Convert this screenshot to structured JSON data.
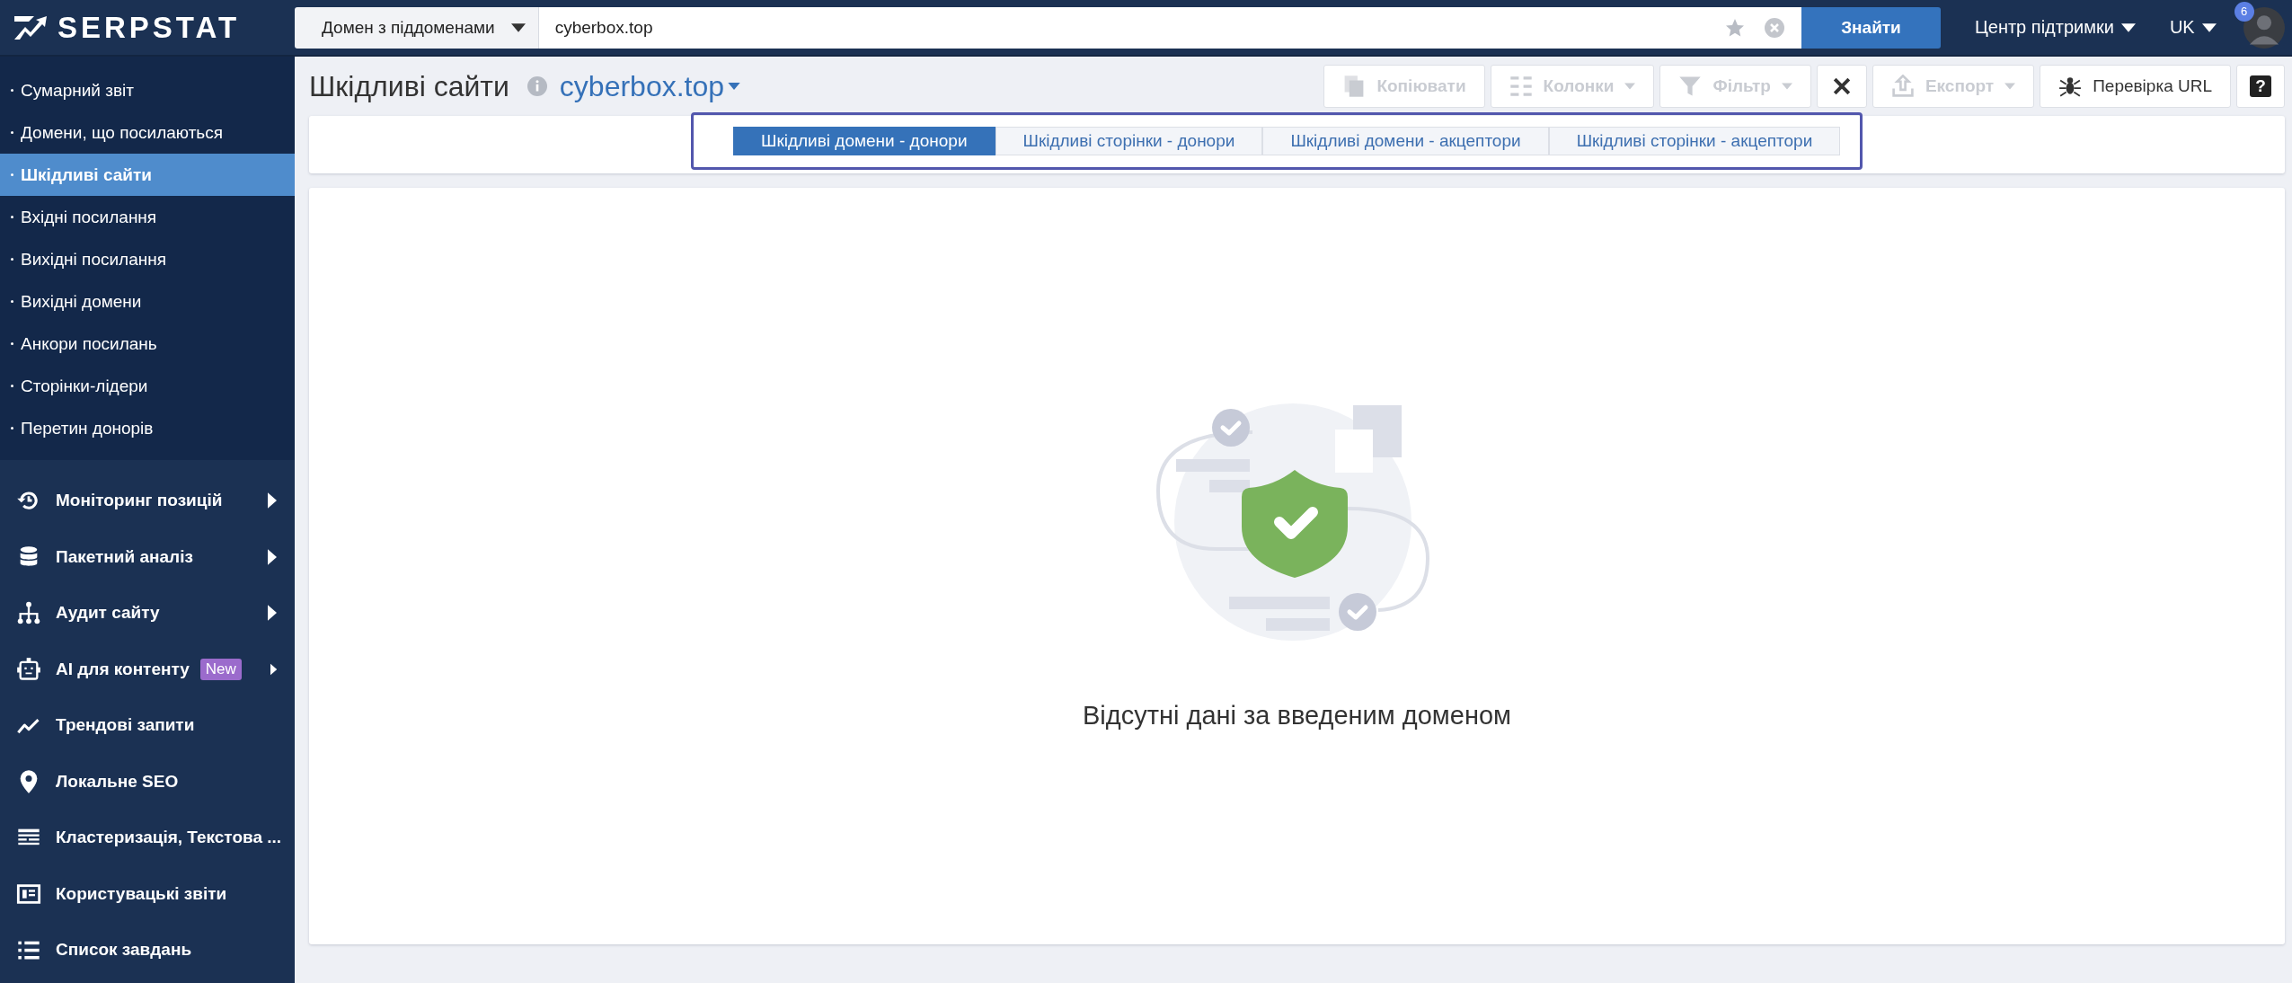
{
  "header": {
    "logo": "SERPSTAT",
    "search_scope": "Домен з піддоменами",
    "search_value": "cyberbox.top",
    "search_button": "Знайти",
    "support": "Центр підтримки",
    "language": "UK",
    "notifications": "6"
  },
  "sidebar": {
    "submenu": [
      {
        "label": "Сумарний звіт",
        "selected": false
      },
      {
        "label": "Домени, що посилаються",
        "selected": false
      },
      {
        "label": "Шкідливі сайти",
        "selected": true
      },
      {
        "label": "Вхідні посилання",
        "selected": false
      },
      {
        "label": "Вихідні посилання",
        "selected": false
      },
      {
        "label": "Вихідні домени",
        "selected": false
      },
      {
        "label": "Анкори посилань",
        "selected": false
      },
      {
        "label": "Сторінки-лідери",
        "selected": false
      },
      {
        "label": "Перетин донорів",
        "selected": false
      }
    ],
    "items": [
      {
        "label": "Моніторинг позицій",
        "expandable": true
      },
      {
        "label": "Пакетний аналіз",
        "expandable": true
      },
      {
        "label": "Аудит сайту",
        "expandable": true
      },
      {
        "label": "AI для контенту",
        "badge": "New",
        "expandable": true
      },
      {
        "label": "Трендові запити",
        "expandable": false
      },
      {
        "label": "Локальне SEO",
        "expandable": false
      },
      {
        "label": "Кластеризація, Текстова ...",
        "expandable": false
      },
      {
        "label": "Користувацькі звіти",
        "expandable": false
      },
      {
        "label": "Список завдань",
        "expandable": false
      }
    ]
  },
  "page": {
    "title": "Шкідливі сайти",
    "domain": "cyberbox.top"
  },
  "toolbar": [
    {
      "kind": "copy",
      "label": "Копіювати",
      "disabled": true
    },
    {
      "kind": "columns",
      "label": "Колонки",
      "disabled": true
    },
    {
      "kind": "filter",
      "label": "Фільтр",
      "disabled": true
    },
    {
      "kind": "clear",
      "disabled": false
    },
    {
      "kind": "export",
      "label": "Експорт",
      "disabled": true
    },
    {
      "kind": "check",
      "label": "Перевірка URL",
      "disabled": false
    },
    {
      "kind": "help",
      "label": "?",
      "disabled": false
    }
  ],
  "tabs": [
    {
      "label": "Шкідливі домени - донори",
      "selected": true
    },
    {
      "label": "Шкідливі сторінки - донори",
      "selected": false
    },
    {
      "label": "Шкідливі домени - акцептори",
      "selected": false
    },
    {
      "label": "Шкідливі сторінки - акцептори",
      "selected": false
    }
  ],
  "empty_message": "Відсутні дані за введеним доменом"
}
